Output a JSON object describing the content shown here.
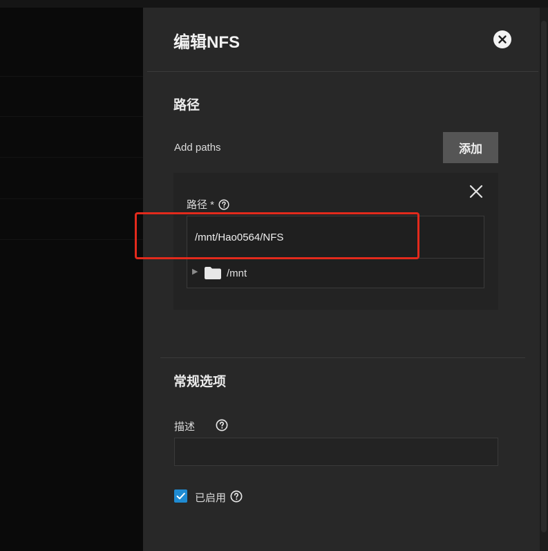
{
  "dialog": {
    "title": "编辑NFS"
  },
  "paths_section": {
    "title": "路径",
    "add_paths_label": "Add paths",
    "add_button_label": "添加",
    "path_field": {
      "label": "路径 *",
      "value": "/mnt/Hao0564/NFS"
    },
    "tree": {
      "root_label": "/mnt",
      "expanded": false
    }
  },
  "general_section": {
    "title": "常规选项",
    "description_label": "描述",
    "description_value": "",
    "enabled_label": "已启用",
    "enabled_checked": true
  },
  "colors": {
    "panel_bg": "#282828",
    "highlight": "#e32a1c",
    "checkbox": "#1f8bd2",
    "button_bg": "#555555"
  }
}
